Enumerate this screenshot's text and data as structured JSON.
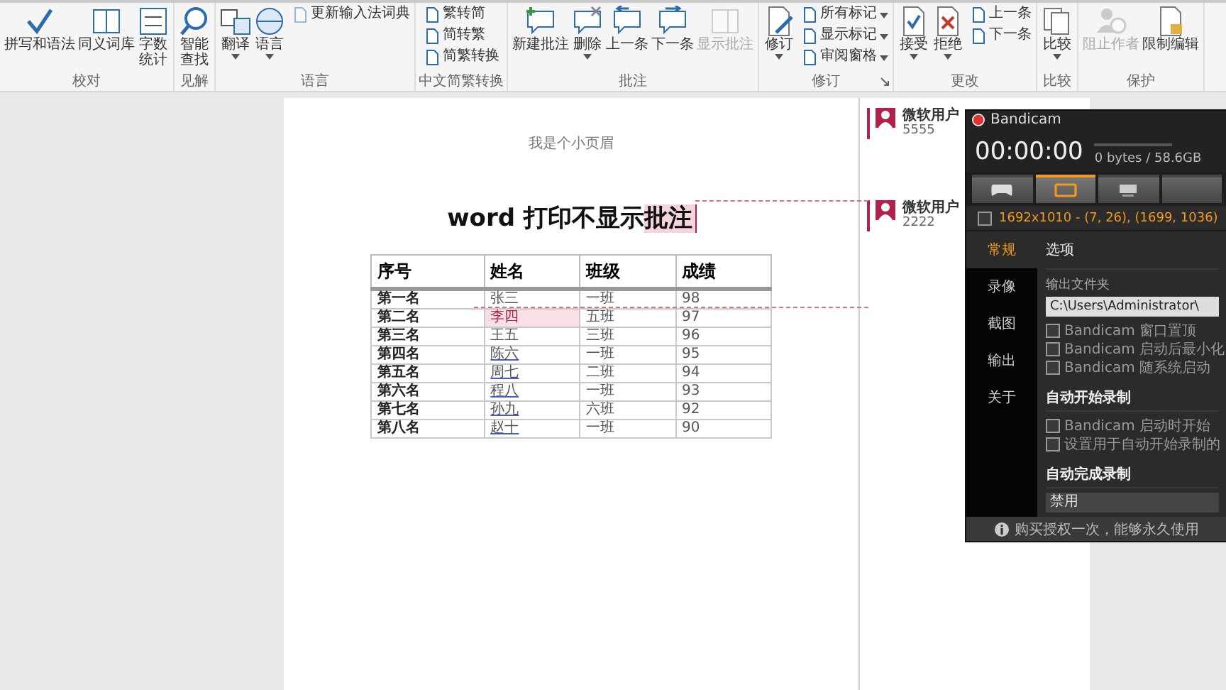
{
  "ribbon": {
    "groups": [
      {
        "title": "校对",
        "launcher": false,
        "items": [
          {
            "kind": "large",
            "lines": [
              "拼写和语法"
            ],
            "dropdown": false,
            "disabled": false
          },
          {
            "kind": "large",
            "lines": [
              "同义词库"
            ],
            "dropdown": false,
            "disabled": false
          },
          {
            "kind": "large",
            "lines": [
              "字数",
              "统计"
            ],
            "dropdown": false,
            "disabled": false
          }
        ]
      },
      {
        "title": "见解",
        "launcher": false,
        "items": [
          {
            "kind": "large",
            "lines": [
              "智能",
              "查找"
            ],
            "dropdown": false,
            "disabled": false
          }
        ]
      },
      {
        "title": "语言",
        "launcher": false,
        "items": [
          {
            "kind": "large",
            "lines": [
              "翻译"
            ],
            "dropdown": true,
            "disabled": false
          },
          {
            "kind": "large",
            "lines": [
              "语言"
            ],
            "dropdown": true,
            "disabled": false
          },
          {
            "kind": "stack",
            "buttons": [
              {
                "label": "更新输入法词典",
                "dropdown": false,
                "disabled": true
              }
            ]
          }
        ]
      },
      {
        "title": "中文简繁转换",
        "launcher": false,
        "items": [
          {
            "kind": "stack",
            "buttons": [
              {
                "label": "繁转简",
                "dropdown": false,
                "disabled": false
              },
              {
                "label": "简转繁",
                "dropdown": false,
                "disabled": false
              },
              {
                "label": "简繁转换",
                "dropdown": false,
                "disabled": false
              }
            ]
          }
        ]
      },
      {
        "title": "批注",
        "launcher": false,
        "items": [
          {
            "kind": "large",
            "lines": [
              "新建批注"
            ],
            "dropdown": false,
            "disabled": false
          },
          {
            "kind": "large",
            "lines": [
              "删除"
            ],
            "dropdown": true,
            "disabled": false
          },
          {
            "kind": "large",
            "lines": [
              "上一条"
            ],
            "dropdown": false,
            "disabled": false
          },
          {
            "kind": "large",
            "lines": [
              "下一条"
            ],
            "dropdown": false,
            "disabled": false
          },
          {
            "kind": "large",
            "lines": [
              "显示批注"
            ],
            "dropdown": false,
            "disabled": true
          }
        ]
      },
      {
        "title": "修订",
        "launcher": true,
        "items": [
          {
            "kind": "large",
            "lines": [
              "修订"
            ],
            "dropdown": true,
            "disabled": false
          },
          {
            "kind": "stack",
            "buttons": [
              {
                "label": "所有标记",
                "dropdown": true,
                "disabled": false
              },
              {
                "label": "显示标记",
                "dropdown": true,
                "disabled": false
              },
              {
                "label": "审阅窗格",
                "dropdown": true,
                "disabled": false
              }
            ]
          }
        ]
      },
      {
        "title": "更改",
        "launcher": false,
        "items": [
          {
            "kind": "large",
            "lines": [
              "接受"
            ],
            "dropdown": true,
            "disabled": false
          },
          {
            "kind": "large",
            "lines": [
              "拒绝"
            ],
            "dropdown": true,
            "disabled": false
          },
          {
            "kind": "stack",
            "buttons": [
              {
                "label": "上一条",
                "dropdown": false,
                "disabled": false
              },
              {
                "label": "下一条",
                "dropdown": false,
                "disabled": false
              }
            ]
          }
        ]
      },
      {
        "title": "比较",
        "launcher": false,
        "items": [
          {
            "kind": "large",
            "lines": [
              "比较"
            ],
            "dropdown": true,
            "disabled": false
          }
        ]
      },
      {
        "title": "保护",
        "launcher": false,
        "items": [
          {
            "kind": "large",
            "lines": [
              "阻止作者"
            ],
            "dropdown": false,
            "disabled": true
          },
          {
            "kind": "large",
            "lines": [
              "限制编辑"
            ],
            "dropdown": false,
            "disabled": false
          }
        ]
      }
    ]
  },
  "document": {
    "header": "我是个小页眉",
    "title": "word 打印不显示",
    "title_commented": "批注",
    "table": {
      "columns": [
        "序号",
        "姓名",
        "班级",
        "成绩"
      ],
      "rows": [
        {
          "rank": "第一名",
          "name": "张三",
          "commented": false,
          "underlined": false,
          "class": "一班",
          "score": "98"
        },
        {
          "rank": "第二名",
          "name": "李四",
          "commented": true,
          "underlined": false,
          "class": "五班",
          "score": "97"
        },
        {
          "rank": "第三名",
          "name": "王五",
          "commented": false,
          "underlined": false,
          "class": "三班",
          "score": "96"
        },
        {
          "rank": "第四名",
          "name": "陈六",
          "commented": false,
          "underlined": true,
          "class": "一班",
          "score": "95"
        },
        {
          "rank": "第五名",
          "name": "周七",
          "commented": false,
          "underlined": true,
          "class": "二班",
          "score": "94"
        },
        {
          "rank": "第六名",
          "name": "程八",
          "commented": false,
          "underlined": true,
          "class": "一班",
          "score": "93"
        },
        {
          "rank": "第七名",
          "name": "孙九",
          "commented": false,
          "underlined": true,
          "class": "六班",
          "score": "92"
        },
        {
          "rank": "第八名",
          "name": "赵十",
          "commented": false,
          "underlined": true,
          "class": "一班",
          "score": "90"
        }
      ]
    }
  },
  "comments": [
    {
      "author": "微软用户",
      "text": "5555"
    },
    {
      "author": "微软用户",
      "text": "2222"
    }
  ],
  "recorder": {
    "title": "Bandicam",
    "timer": "00:00:00",
    "storage": {
      "text": "0 bytes / 58.6GB"
    },
    "modes": [
      {
        "selected": false
      },
      {
        "selected": true
      },
      {
        "selected": false
      },
      {
        "selected": false
      }
    ],
    "region": {
      "checked": false,
      "text": "1692x1010 - (7, 26), (1699, 1036)"
    },
    "nav": [
      {
        "label": "常规",
        "selected": true
      },
      {
        "label": "录像",
        "selected": false
      },
      {
        "label": "截图",
        "selected": false
      },
      {
        "label": "输出",
        "selected": false
      },
      {
        "label": "关于",
        "selected": false
      }
    ],
    "heading": "选项",
    "folder_label": "输出文件夹",
    "folder": "C:\\Users\\Administrator\\",
    "options": [
      {
        "label": "Bandicam 窗口置顶",
        "checked": false
      },
      {
        "label": "Bandicam 启动后最小化",
        "checked": false
      },
      {
        "label": "Bandicam 随系统启动",
        "checked": false
      }
    ],
    "auto_start": {
      "heading": "自动开始录制",
      "options": [
        {
          "label": "Bandicam 启动时开始",
          "checked": false
        },
        {
          "label": "设置用于自动开始录制的",
          "checked": false
        }
      ]
    },
    "auto_stop": {
      "heading": "自动完成录制",
      "value": "禁用"
    },
    "footer": "购买授权一次，能够永久使用"
  }
}
